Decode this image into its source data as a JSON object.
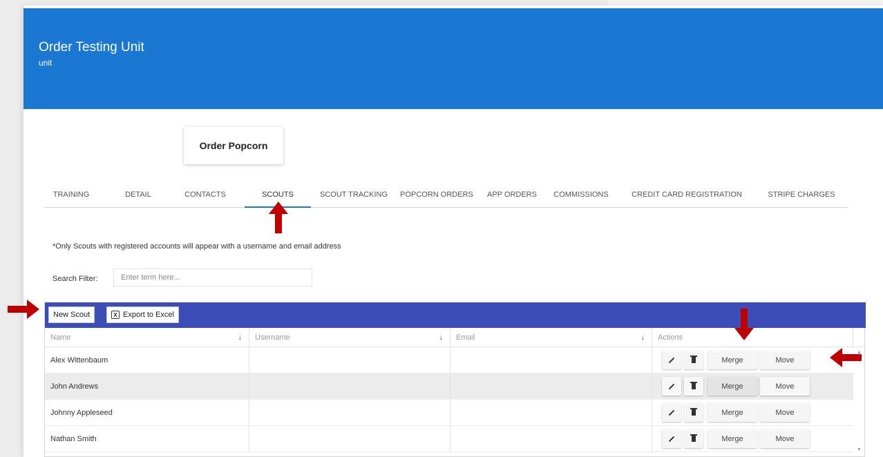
{
  "banner": {
    "title": "Order Testing Unit",
    "subtitle": "unit"
  },
  "order_button": "Order Popcorn",
  "tabs": [
    {
      "label": "TRAINING",
      "active": false
    },
    {
      "label": "DETAIL",
      "active": false
    },
    {
      "label": "CONTACTS",
      "active": false
    },
    {
      "label": "SCOUTS",
      "active": true
    },
    {
      "label": "SCOUT TRACKING",
      "active": false
    },
    {
      "label": "POPCORN ORDERS",
      "active": false
    },
    {
      "label": "APP ORDERS",
      "active": false
    },
    {
      "label": "COMMISSIONS",
      "active": false
    },
    {
      "label": "CREDIT CARD REGISTRATION",
      "active": false
    },
    {
      "label": "STRIPE CHARGES",
      "active": false
    }
  ],
  "note": "*Only Scouts with registered accounts will appear with a username and email address",
  "search": {
    "label": "Search Filter:",
    "placeholder": "Enter term here..."
  },
  "toolbar": {
    "new_scout": "New Scout",
    "export": "Export to Excel"
  },
  "columns": [
    {
      "label": "Name",
      "sort_icon": "↓"
    },
    {
      "label": "Username",
      "sort_icon": "↓"
    },
    {
      "label": "Email",
      "sort_icon": "↓"
    },
    {
      "label": "Actions"
    }
  ],
  "actions": {
    "merge": "Merge",
    "move": "Move"
  },
  "rows": [
    {
      "name": "Alex Wittenbaum",
      "username": "",
      "email": ""
    },
    {
      "name": "John Andrews",
      "username": "",
      "email": ""
    },
    {
      "name": "Johnny Appleseed",
      "username": "",
      "email": ""
    },
    {
      "name": "Nathan Smith",
      "username": "",
      "email": ""
    }
  ],
  "colors": {
    "banner": "#1b78d2",
    "toolbar": "#3d4db8",
    "annotation_arrow": "#c00000"
  }
}
